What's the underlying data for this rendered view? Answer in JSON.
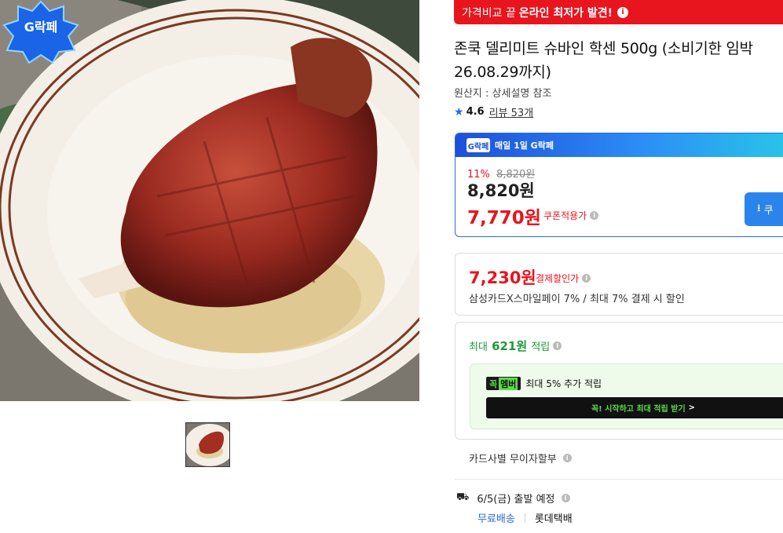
{
  "image": {
    "hero_alt": "roast pork knuckle on sauerkraut",
    "logo_text": "G락페"
  },
  "banner": {
    "prefix": "가격비교 끝",
    "highlight": "온라인 최저가 발견!",
    "icon": "info-icon"
  },
  "product": {
    "title": "존쿡 델리미트 슈바인 학센 500g (소비기한 임박 26.08.29까지)",
    "origin": "원산지 : 상세설명 참조",
    "rating": "4.6",
    "review_link": "리뷰 53개"
  },
  "g_promo": {
    "badge": "G락페",
    "header": "매일 1일 G락페",
    "discount_pct": "11%",
    "original_price": "8,820원",
    "sale_price": "8,820원",
    "coupon_price": "7,770원",
    "coupon_label": "쿠폰적용가",
    "download_button": "쿠"
  },
  "payment": {
    "price": "7,230원",
    "label": "결제할인가",
    "desc": "삼성카드X스마일페이 7% / 최대 7% 결제 시 할인"
  },
  "reward": {
    "prefix": "최대",
    "amount": "621원",
    "suffix": "적립",
    "member_badge_k": "꼭",
    "member_badge_m": "멤버",
    "member_text": "최대 5% 추가 적립",
    "cta": "꼭! 시작하고 최대 적립 받기",
    "cta_arrow": ">"
  },
  "installment": "카드사별 무이자할부",
  "shipping": {
    "date": "6/5(금) 출발 예정",
    "free": "무료배송",
    "carrier": "롯데택배"
  },
  "colors": {
    "accent_red": "#e8141e",
    "accent_blue": "#2a6ae0",
    "reward_green": "#1d9a3a"
  }
}
